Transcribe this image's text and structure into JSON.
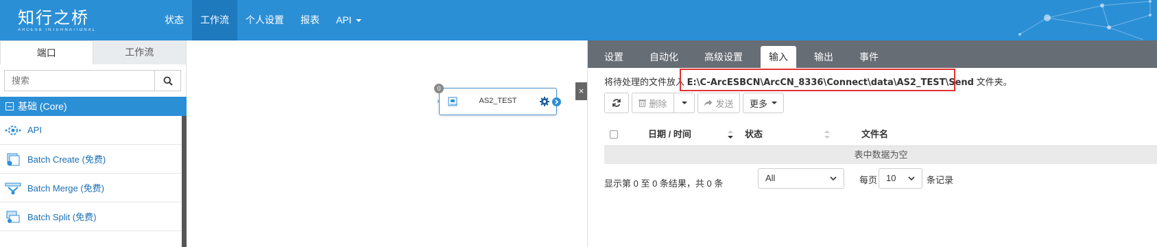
{
  "app": {
    "logo_cn": "知行之桥",
    "logo_en": "ARCESB INTERNATIONAL"
  },
  "nav": {
    "items": [
      "状态",
      "工作流",
      "个人设置",
      "报表",
      "API"
    ],
    "active": "工作流"
  },
  "sidebar": {
    "tabs": [
      "端口",
      "工作流"
    ],
    "search_placeholder": "搜索",
    "category": "基础 (Core)",
    "connectors": [
      "API",
      "Batch Create (免费)",
      "Batch Merge (免费)",
      "Batch Split (免费)"
    ]
  },
  "canvas": {
    "node_name": "AS2_TEST",
    "node_badge": "0",
    "close": "×"
  },
  "panel": {
    "tabs": [
      "设置",
      "自动化",
      "高级设置",
      "输入",
      "输出",
      "事件"
    ],
    "active_tab": "输入",
    "info_prefix": "将待处理的文件放入",
    "info_path": "E:\\C-ArcESBCN\\ArcCN_8336\\Connect\\data\\AS2_TEST\\Send",
    "info_suffix": "文件夹。",
    "toolbar": {
      "delete": "删除",
      "send": "发送",
      "more": "更多"
    },
    "table": {
      "headers": [
        "日期 / 时间",
        "状态",
        "文件名"
      ],
      "empty": "表中数据为空"
    },
    "footer": {
      "summary": "显示第 0 至 0 条结果，共 0 条",
      "filter": "All",
      "per_page_label": "每页",
      "per_page_value": "10",
      "records_label": "条记录"
    }
  },
  "colors": {
    "topbar": "#2b8fd6",
    "highlight": "#e03232"
  }
}
